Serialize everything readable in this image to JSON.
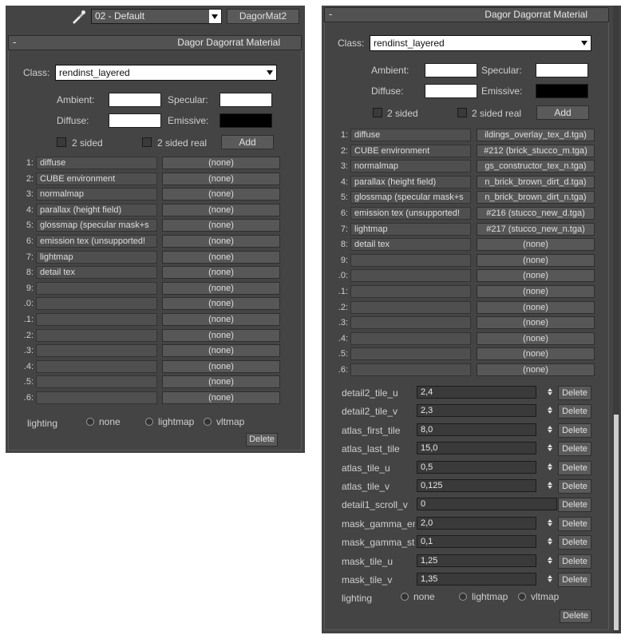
{
  "left": {
    "material_name": "02 - Default",
    "material_type_button": "DagorMat2",
    "rollout_title": "Dagor Dagorrat Material",
    "class_label": "Class:",
    "class_value": "rendinst_layered",
    "ambient_label": "Ambient:",
    "specular_label": "Specular:",
    "diffuse_label": "Diffuse:",
    "emissive_label": "Emissive:",
    "two_sided_label": "2 sided",
    "two_sided_real_label": "2 sided real",
    "add_label": "Add",
    "slots": [
      {
        "num": "1:",
        "name": "diffuse",
        "tex": "(none)"
      },
      {
        "num": "2:",
        "name": "CUBE environment",
        "tex": "(none)"
      },
      {
        "num": "3:",
        "name": "normalmap",
        "tex": "(none)"
      },
      {
        "num": "4:",
        "name": "parallax (height field)",
        "tex": "(none)"
      },
      {
        "num": "5:",
        "name": "glossmap (specular mask+s",
        "tex": "(none)"
      },
      {
        "num": "6:",
        "name": "emission tex (unsupported!",
        "tex": "(none)"
      },
      {
        "num": "7:",
        "name": "lightmap",
        "tex": "(none)"
      },
      {
        "num": "8:",
        "name": "detail tex",
        "tex": "(none)"
      },
      {
        "num": "9:",
        "name": "",
        "tex": "(none)"
      },
      {
        "num": ".0:",
        "name": "",
        "tex": "(none)"
      },
      {
        "num": ".1:",
        "name": "",
        "tex": "(none)"
      },
      {
        "num": ".2:",
        "name": "",
        "tex": "(none)"
      },
      {
        "num": ".3:",
        "name": "",
        "tex": "(none)"
      },
      {
        "num": ".4:",
        "name": "",
        "tex": "(none)"
      },
      {
        "num": ".5:",
        "name": "",
        "tex": "(none)"
      },
      {
        "num": ".6:",
        "name": "",
        "tex": "(none)"
      }
    ],
    "lighting_label": "lighting",
    "lighting_options": [
      "none",
      "lightmap",
      "vltmap"
    ],
    "delete_label": "Delete"
  },
  "right": {
    "rollout_title": "Dagor Dagorrat Material",
    "class_label": "Class:",
    "class_value": "rendinst_layered",
    "ambient_label": "Ambient:",
    "specular_label": "Specular:",
    "diffuse_label": "Diffuse:",
    "emissive_label": "Emissive:",
    "two_sided_label": "2 sided",
    "two_sided_real_label": "2 sided real",
    "add_label": "Add",
    "slots": [
      {
        "num": "1:",
        "name": "diffuse",
        "tex": "ildings_overlay_tex_d.tga)"
      },
      {
        "num": "2:",
        "name": "CUBE environment",
        "tex": "#212 (brick_stucco_m.tga)"
      },
      {
        "num": "3:",
        "name": "normalmap",
        "tex": "gs_constructor_tex_n.tga)"
      },
      {
        "num": "4:",
        "name": "parallax (height field)",
        "tex": "n_brick_brown_dirt_d.tga)"
      },
      {
        "num": "5:",
        "name": "glossmap (specular mask+s",
        "tex": "n_brick_brown_dirt_n.tga)"
      },
      {
        "num": "6:",
        "name": "emission tex (unsupported!",
        "tex": "#216 (stucco_new_d.tga)"
      },
      {
        "num": "7:",
        "name": "lightmap",
        "tex": "#217 (stucco_new_n.tga)"
      },
      {
        "num": "8:",
        "name": "detail tex",
        "tex": "(none)"
      },
      {
        "num": "9:",
        "name": "",
        "tex": "(none)"
      },
      {
        "num": ".0:",
        "name": "",
        "tex": "(none)"
      },
      {
        "num": ".1:",
        "name": "",
        "tex": "(none)"
      },
      {
        "num": ".2:",
        "name": "",
        "tex": "(none)"
      },
      {
        "num": ".3:",
        "name": "",
        "tex": "(none)"
      },
      {
        "num": ".4:",
        "name": "",
        "tex": "(none)"
      },
      {
        "num": ".5:",
        "name": "",
        "tex": "(none)"
      },
      {
        "num": ".6:",
        "name": "",
        "tex": "(none)"
      }
    ],
    "params": [
      {
        "name": "detail2_tile_u",
        "value": "2,4",
        "spinner": true
      },
      {
        "name": "detail2_tile_v",
        "value": "2,3",
        "spinner": true
      },
      {
        "name": "atlas_first_tile",
        "value": "8,0",
        "spinner": true
      },
      {
        "name": "atlas_last_tile",
        "value": "15,0",
        "spinner": true
      },
      {
        "name": "atlas_tile_u",
        "value": "0,5",
        "spinner": true
      },
      {
        "name": "atlas_tile_v",
        "value": "0,125",
        "spinner": true
      },
      {
        "name": "detail1_scroll_v",
        "value": "0",
        "spinner": false
      },
      {
        "name": "mask_gamma_en",
        "value": "2,0",
        "spinner": true
      },
      {
        "name": "mask_gamma_sta",
        "value": "0,1",
        "spinner": true
      },
      {
        "name": "mask_tile_u",
        "value": "1,25",
        "spinner": true
      },
      {
        "name": "mask_tile_v",
        "value": "1,35",
        "spinner": true
      }
    ],
    "param_delete_label": "Delete",
    "lighting_label": "lighting",
    "lighting_options": [
      "none",
      "lightmap",
      "vltmap"
    ],
    "delete_label": "Delete"
  },
  "colors": {
    "panel_bg": "#444444",
    "ambient": "#ffffff",
    "specular": "#ffffff",
    "diffuse": "#ffffff",
    "emissive": "#000000"
  },
  "icons": {
    "eyedropper": "eyedropper-icon"
  }
}
